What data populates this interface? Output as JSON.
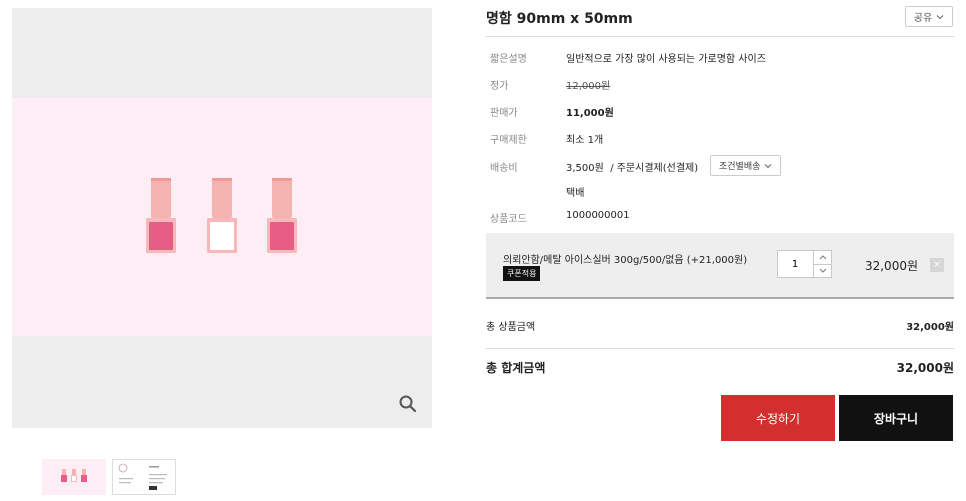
{
  "product": {
    "title": "명함 90mm x 50mm",
    "share_label": "공유",
    "details": [
      {
        "label": "짧은설명",
        "value": "일반적으로 가장 많이 사용되는 가로명함 사이즈"
      },
      {
        "label": "정가",
        "value": "12,000원"
      },
      {
        "label": "판매가",
        "value": "11,000원"
      },
      {
        "label": "구매제한",
        "value": "최소 1개"
      },
      {
        "label": "배송비",
        "value": "3,500원",
        "value_extra": "/ 주문시결제(선결제)",
        "button": "조건별배송",
        "sub_value": "택배"
      },
      {
        "label": "상품코드",
        "value": "1000000001"
      }
    ]
  },
  "option": {
    "name": "의뢰안함/메탈 아이스실버 300g/500/없음 (+21,000원)",
    "coupon_label": "쿠폰적용",
    "quantity": "1",
    "price": "32,000원",
    "delete_label": "×"
  },
  "summary": {
    "subtotal_label": "총 상품금액",
    "subtotal_value": "32,000원",
    "total_label": "총 합계금액",
    "total_value": "32,000원"
  },
  "actions": {
    "edit_label": "수정하기",
    "cart_label": "장바구니"
  },
  "icons": {
    "zoom": "magnifier-icon",
    "share_caret": "chevron-down-icon",
    "qty_up": "chevron-up-icon",
    "qty_down": "chevron-down-icon"
  },
  "colors": {
    "primary_button": "#d32f2f",
    "secondary_button": "#111111",
    "polish_dark": "#e85d86",
    "polish_light": "#ffffff",
    "background_pink": "#fceef4"
  }
}
